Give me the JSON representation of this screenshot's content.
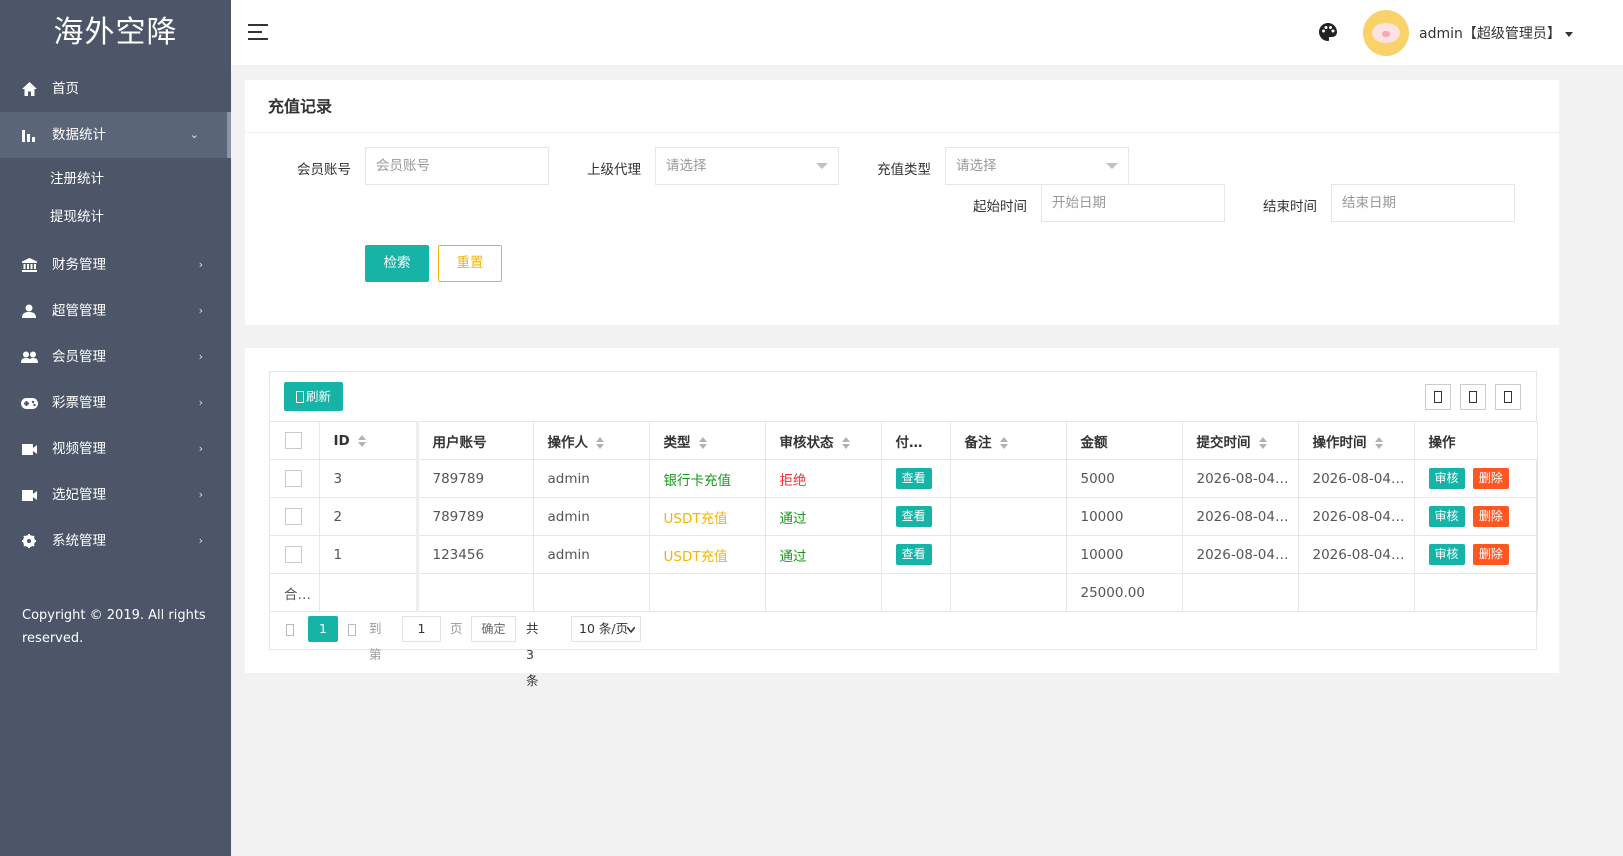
{
  "sidebar": {
    "logo": "海外空降",
    "items": [
      {
        "label": "首页"
      },
      {
        "label": "数据统计",
        "arrow": "⌄"
      },
      {
        "label": "财务管理",
        "arrow": "›"
      },
      {
        "label": "超管管理",
        "arrow": "›"
      },
      {
        "label": "会员管理",
        "arrow": "›"
      },
      {
        "label": "彩票管理",
        "arrow": "›"
      },
      {
        "label": "视频管理",
        "arrow": "›"
      },
      {
        "label": "选妃管理",
        "arrow": "›"
      },
      {
        "label": "系统管理",
        "arrow": "›"
      }
    ],
    "sub_items": [
      "注册统计",
      "提现统计"
    ],
    "copyright": "Copyright © 2019. All rights reserved."
  },
  "header": {
    "user": "admin【超级管理员】"
  },
  "search": {
    "title": "充值记录",
    "member_label": "会员账号",
    "member_placeholder": "会员账号",
    "agent_label": "上级代理",
    "agent_value": "请选择",
    "type_label": "充值类型",
    "type_value": "请选择",
    "start_label": "起始时间",
    "start_placeholder": "开始日期",
    "end_label": "结束时间",
    "end_placeholder": "结束日期",
    "search_btn": "检索",
    "reset_btn": "重置"
  },
  "table": {
    "refresh_btn": "刷新",
    "columns": [
      "ID",
      "用户账号",
      "操作人",
      "类型",
      "审核状态",
      "付…",
      "备注",
      "金额",
      "提交时间",
      "操作时间",
      "操作"
    ],
    "rows": [
      {
        "id": "3",
        "user": "789789",
        "operator": "admin",
        "type": "银行卡充值",
        "status": "拒绝",
        "pay": "查看",
        "note": "",
        "amount": "5000",
        "submit_time": "2026-08-04…",
        "op_time": "2026-08-04…",
        "audit": "审核",
        "delete": "删除"
      },
      {
        "id": "2",
        "user": "789789",
        "operator": "admin",
        "type": "USDT充值",
        "status": "通过",
        "pay": "查看",
        "note": "",
        "amount": "10000",
        "submit_time": "2026-08-04…",
        "op_time": "2026-08-04…",
        "audit": "审核",
        "delete": "删除"
      },
      {
        "id": "1",
        "user": "123456",
        "operator": "admin",
        "type": "USDT充值",
        "status": "通过",
        "pay": "查看",
        "note": "",
        "amount": "10000",
        "submit_time": "2026-08-04…",
        "op_time": "2026-08-04…",
        "audit": "审核",
        "delete": "删除"
      }
    ],
    "total_label": "合…",
    "total_amount": "25000.00"
  },
  "pager": {
    "current": "1",
    "goto_label": "到第",
    "goto_value": "1",
    "page_unit": "页",
    "confirm": "确定",
    "total": "共 3 条",
    "per_page": "10 条/页"
  },
  "colors": {
    "sidebar_bg": "#4c5668",
    "teal": "#16b4a6",
    "orange": "#ff5722",
    "yellow": "#f5b400"
  }
}
